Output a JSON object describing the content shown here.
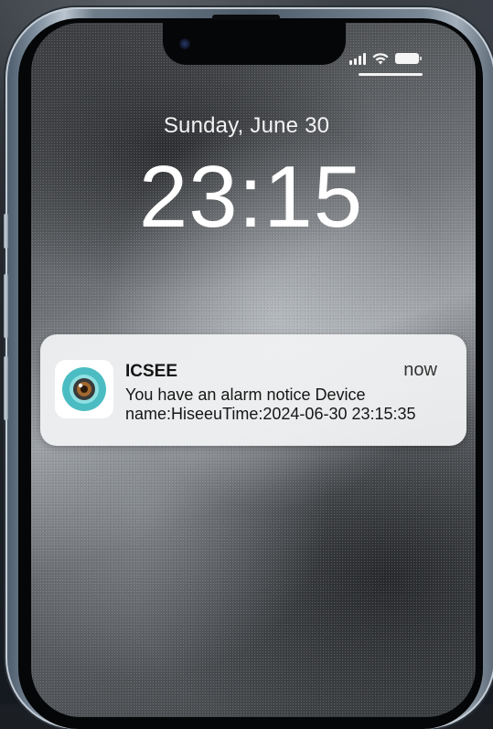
{
  "lockscreen": {
    "date": "Sunday, June 30",
    "time": "23:15"
  },
  "status_bar": {
    "signal_icon": "cellular-signal-icon",
    "wifi_icon": "wifi-icon",
    "battery_icon": "battery-icon"
  },
  "notification": {
    "app_name": "ICSEE",
    "timestamp": "now",
    "line1": "You have an alarm notice Device",
    "line2": "name:HiseeuTime:2024-06-30 23:15:35",
    "icon": "camera-lens-app-icon",
    "icon_color": "#4bbdc2"
  }
}
